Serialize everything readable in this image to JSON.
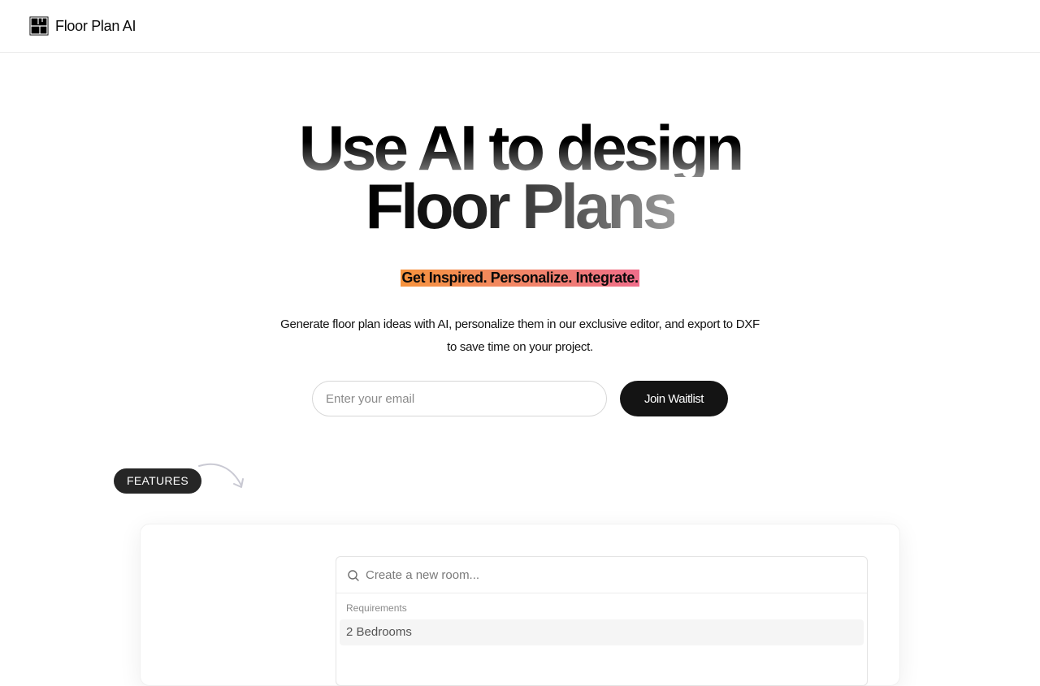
{
  "header": {
    "brand_name": "Floor Plan AI",
    "logo_icon": "floor-plan-logo-icon"
  },
  "hero": {
    "title_line1": "Use AI to design",
    "title_line2": "Floor Plans",
    "tagline": "Get Inspired. Personalize. Integrate.",
    "description": "Generate floor plan ideas with AI, personalize them in our exclusive editor, and export to DXF to save time on your project."
  },
  "waitlist": {
    "email_placeholder": "Enter your email",
    "email_value": "",
    "button_label": "Join Waitlist"
  },
  "features": {
    "badge_label": "FEATURES",
    "arrow_icon": "curved-arrow-icon"
  },
  "command_menu": {
    "search_icon": "search-icon",
    "placeholder": "Create a new room...",
    "group_heading": "Requirements",
    "items": [
      {
        "label": "2 Bedrooms"
      }
    ]
  },
  "colors": {
    "tagline_gradient_start": "#f6933d",
    "tagline_gradient_end": "#ef6d8a",
    "button_bg": "#141414",
    "badge_bg": "#262626"
  }
}
